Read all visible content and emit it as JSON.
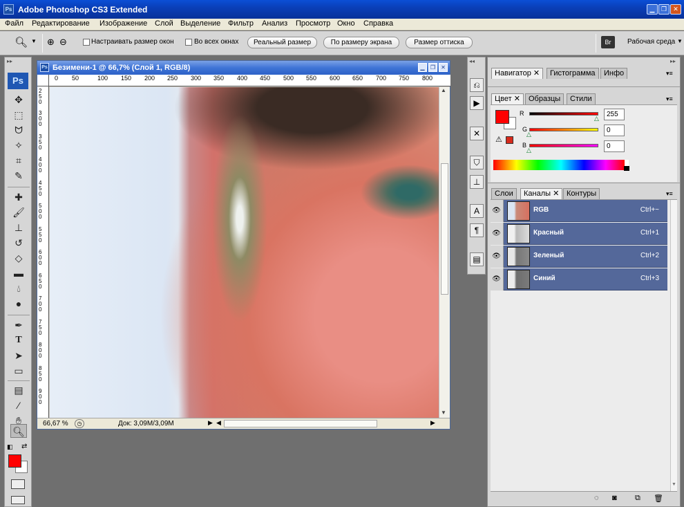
{
  "window": {
    "title": "Adobe Photoshop CS3 Extended",
    "logo": "Ps"
  },
  "menu": [
    "Файл",
    "Редактирование",
    "Изображение",
    "Слой",
    "Выделение",
    "Фильтр",
    "Анализ",
    "Просмотр",
    "Окно",
    "Справка"
  ],
  "options": {
    "resize_windows_label": "Настраивать размер окон",
    "all_windows_label": "Во всех окнах",
    "actual_pixels": "Реальный размер",
    "fit_screen": "По размеру экрана",
    "print_size": "Размер оттиска",
    "workspace": "Рабочая среда",
    "bridge_label": "Br"
  },
  "tools": {
    "logo": "Ps"
  },
  "document": {
    "title": "Безимени-1 @ 66,7% (Слой 1, RGB/8)",
    "zoom": "66,67 %",
    "doc_info": "Док: 3,09M/3,09M",
    "ruler_top": [
      "0",
      "50",
      "100",
      "150",
      "200",
      "250",
      "300",
      "350",
      "400",
      "450",
      "500",
      "550",
      "600",
      "650",
      "700",
      "750",
      "800"
    ],
    "ruler_left": [
      "2",
      "5",
      "0",
      "3",
      "0",
      "0",
      "3",
      "5",
      "0",
      "4",
      "0",
      "0",
      "4",
      "5",
      "0",
      "5",
      "0",
      "0",
      "5",
      "5",
      "0",
      "6",
      "0",
      "0",
      "6",
      "5",
      "0",
      "7",
      "0",
      "0",
      "7",
      "5",
      "0",
      "8",
      "0",
      "0",
      "8",
      "5",
      "0",
      "9",
      "0",
      "0",
      "9",
      "5",
      "0"
    ]
  },
  "panels": {
    "group1_tabs": [
      "Навигатор",
      "Гистограмма",
      "Инфо"
    ],
    "group2_tabs": [
      "Цвет",
      "Образцы",
      "Стили"
    ],
    "color": {
      "r_label": "R",
      "g_label": "G",
      "b_label": "B",
      "r_value": "255",
      "g_value": "0",
      "b_value": "0",
      "foreground": "#ff0000",
      "background": "#ffffff"
    },
    "group3_tabs": [
      "Слои",
      "Каналы",
      "Контуры"
    ],
    "channels": [
      {
        "name": "RGB",
        "shortcut": "Ctrl+~"
      },
      {
        "name": "Красный",
        "shortcut": "Ctrl+1"
      },
      {
        "name": "Зеленый",
        "shortcut": "Ctrl+2"
      },
      {
        "name": "Синий",
        "shortcut": "Ctrl+3"
      }
    ]
  },
  "colors": {
    "accent_blue": "#0a3fb8",
    "channel_row": "#54689a",
    "foreground_swatch": "#ff0000"
  }
}
